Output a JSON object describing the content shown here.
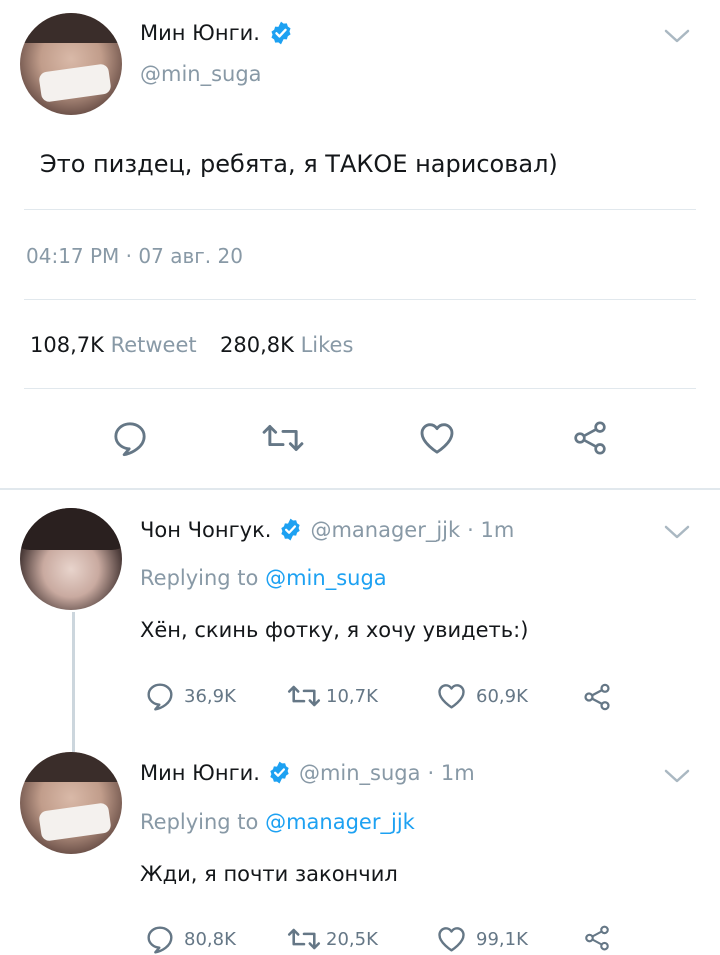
{
  "main_tweet": {
    "display_name": "Мин Юнги.",
    "handle": "@min_suga",
    "text": "Это пиздец, ребята, я ТАКОЕ нарисовал)",
    "time": "04:17 PM",
    "date": "07 авг. 20",
    "retweet_count": "108,7K",
    "retweet_label": "Retweet",
    "like_count": "280,8K",
    "like_label": "Likes"
  },
  "replies": [
    {
      "display_name": "Чон Чонгук.",
      "handle": "@manager_jjk",
      "age": "· 1m",
      "replying_prefix": "Replying to",
      "replying_to": "@min_suga",
      "text": "Хён, скинь фотку, я хочу увидеть:)",
      "reply_count": "36,9K",
      "retweet_count": "10,7K",
      "like_count": "60,9K"
    },
    {
      "display_name": "Мин Юнги.",
      "handle": "@min_suga",
      "age": "· 1m",
      "replying_prefix": "Replying to",
      "replying_to": "@manager_jjk",
      "text": "Жди, я почти закончил",
      "reply_count": "80,8K",
      "retweet_count": "20,5K",
      "like_count": "99,1K"
    }
  ],
  "icons": {
    "verified": "verified-badge-icon",
    "chevron": "chevron-down-icon",
    "reply": "reply-icon",
    "retweet": "retweet-icon",
    "like": "heart-icon",
    "share": "share-icon"
  },
  "colors": {
    "accent": "#1da1f2",
    "secondary_text": "#8899a6",
    "divider": "#e1e8ed"
  }
}
